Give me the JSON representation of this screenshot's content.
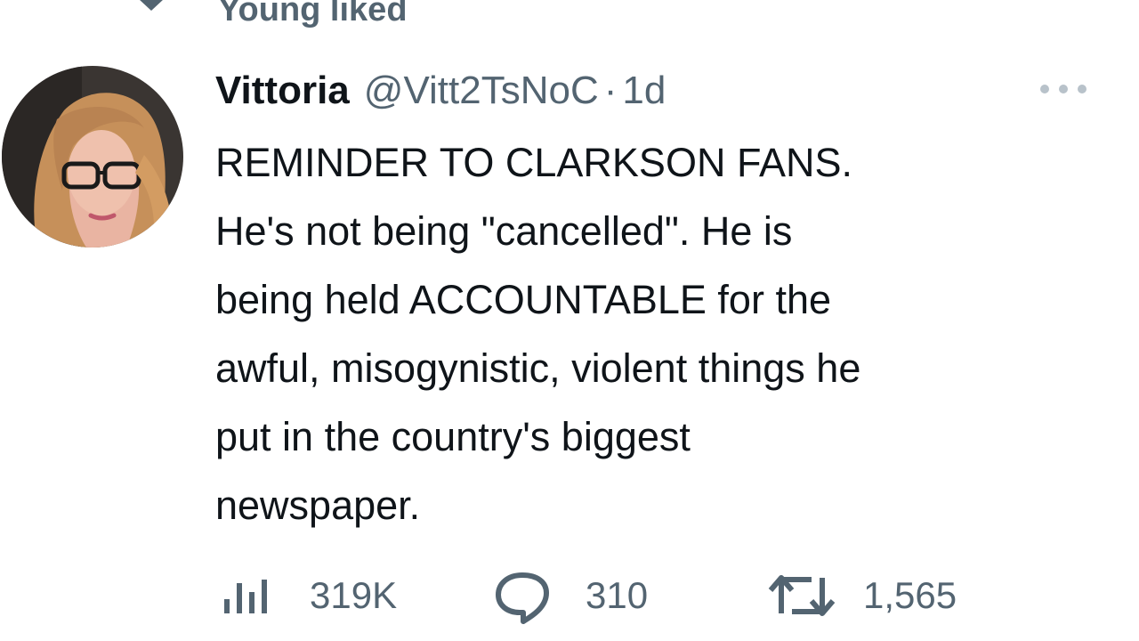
{
  "social_context": {
    "text": "Young liked",
    "icon": "heart-icon"
  },
  "tweet": {
    "display_name": "Vittoria",
    "handle": "@Vitt2TsNoC",
    "separator": "·",
    "timestamp": "1d",
    "more_icon": "more-horizontal-icon",
    "body_lines": [
      "REMINDER TO CLARKSON FANS.",
      "He's not being \"cancelled\". He is",
      "being held ACCOUNTABLE for the",
      "awful, misogynistic, violent things he",
      "put in the country's biggest",
      "newspaper."
    ],
    "stats": {
      "views": "319K",
      "replies": "310",
      "retweets": "1,565"
    }
  },
  "colors": {
    "text_primary": "#0f1419",
    "text_secondary": "#536471",
    "background": "#ffffff"
  }
}
